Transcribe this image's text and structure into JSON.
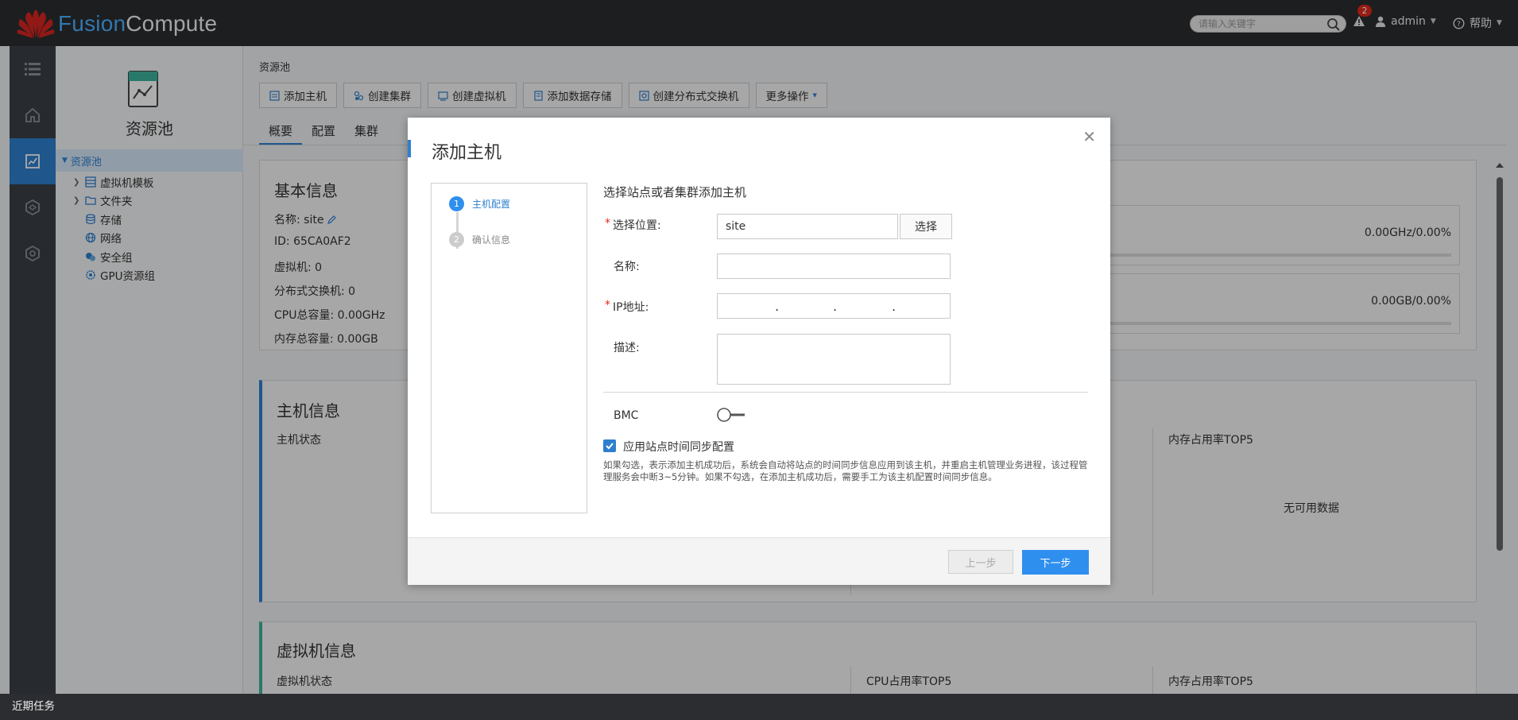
{
  "app": {
    "brand_part1": "Fusion",
    "brand_part2": "Compute"
  },
  "header": {
    "search_placeholder": "请输入关键字",
    "alert_count": "2",
    "user": "admin",
    "help": "帮助"
  },
  "tree": {
    "pool_title": "资源池",
    "root": "资源池",
    "items": [
      {
        "label": "虚拟机模板",
        "icon": "template-icon"
      },
      {
        "label": "文件夹",
        "icon": "folder-icon"
      },
      {
        "label": "存储",
        "icon": "storage-icon"
      },
      {
        "label": "网络",
        "icon": "network-icon"
      },
      {
        "label": "安全组",
        "icon": "security-group-icon"
      },
      {
        "label": "GPU资源组",
        "icon": "gpu-icon"
      }
    ]
  },
  "main": {
    "breadcrumb": "资源池",
    "toolbar": [
      "添加主机",
      "创建集群",
      "创建虚拟机",
      "添加数据存储",
      "创建分布式交换机",
      "更多操作"
    ],
    "tabs": [
      "概要",
      "配置",
      "集群"
    ],
    "basic": {
      "title": "基本信息",
      "name_label": "名称: site",
      "id": "ID: 65CA0AF2",
      "vms": "虚拟机: 0",
      "dvs": "分布式交换机: 0",
      "cpu": "CPU总容量: 0.00GHz",
      "mem": "内存总容量: 0.00GB",
      "cpu_usage": "0.00GHz/0.00%",
      "mem_usage": "0.00GB/0.00%"
    },
    "host": {
      "title": "主机信息",
      "status": "主机状态",
      "mem_top": "内存占用率TOP5",
      "nodata": "无可用数据"
    },
    "vm": {
      "title": "虚拟机信息",
      "status": "虚拟机状态",
      "cpu_top": "CPU占用率TOP5",
      "mem_top": "内存占用率TOP5"
    }
  },
  "modal": {
    "title": "添加主机",
    "steps": [
      {
        "num": "1",
        "label": "主机配置"
      },
      {
        "num": "2",
        "label": "确认信息"
      }
    ],
    "heading": "选择站点或者集群添加主机",
    "location_label": "选择位置:",
    "location_value": "site",
    "select_button": "选择",
    "name_label": "名称:",
    "ip_label": "IP地址:",
    "desc_label": "描述:",
    "bmc_label": "BMC",
    "bmc_on": false,
    "sync_checked": true,
    "sync_label": "应用站点时间同步配置",
    "sync_note": "如果勾选，表示添加主机成功后，系统会自动将站点的时间同步信息应用到该主机，并重启主机管理业务进程，该过程管理服务会中断3~5分钟。如果不勾选，在添加主机成功后，需要手工为该主机配置时间同步信息。",
    "prev": "上一步",
    "next": "下一步"
  },
  "footer": {
    "recent_tasks": "近期任务"
  },
  "colors": {
    "accent": "#2f7fcf",
    "topbar": "#2b2d30",
    "primary_button": "#2f8fee"
  }
}
